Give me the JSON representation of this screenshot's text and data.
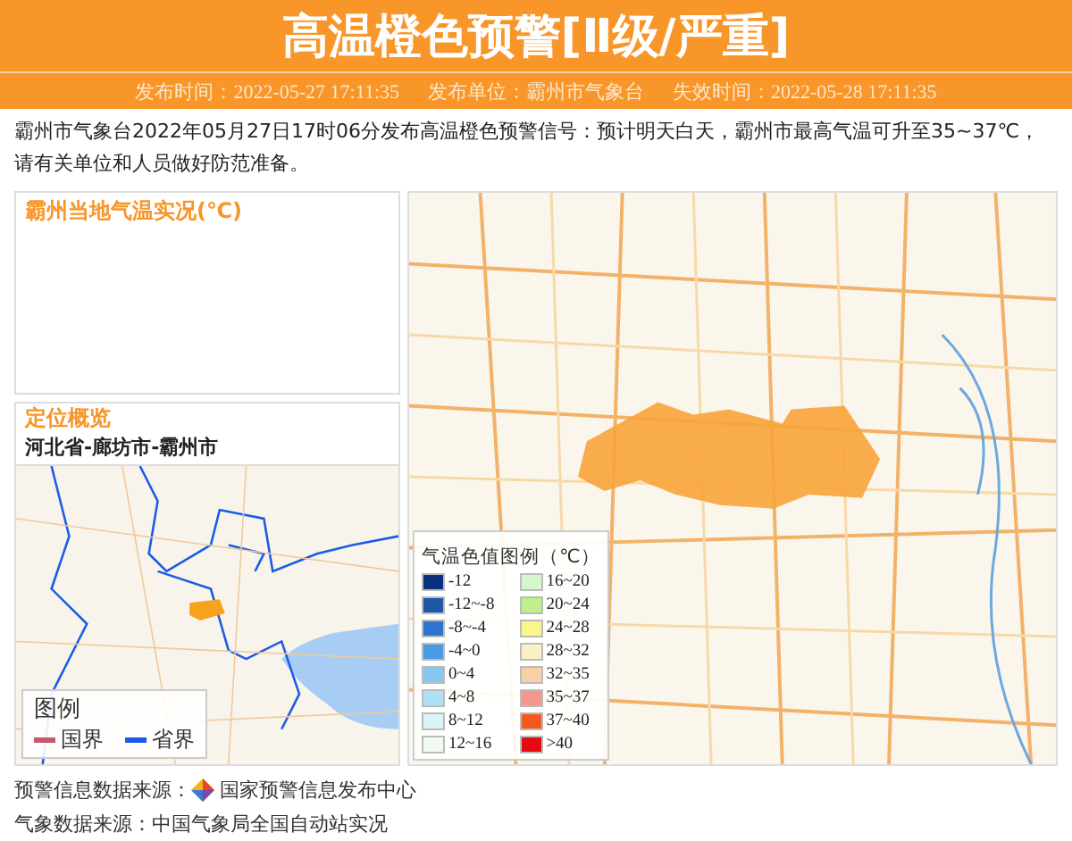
{
  "header": {
    "title": "高温橙色预警[Ⅱ级/严重]"
  },
  "meta": [
    {
      "label": "发布时间：",
      "value": "2022-05-27 17:11:35"
    },
    {
      "label": "发布单位：",
      "value": "霸州市气象台"
    },
    {
      "label": "失效时间：",
      "value": "2022-05-28 17:11:35"
    }
  ],
  "description": "霸州市气象台2022年05月27日17时06分发布高温橙色预警信号：预计明天白天，霸州市最高气温可升至35~37℃，请有关单位和人员做好防范准备。",
  "temperature_panel": {
    "title": "霸州当地气温实况(℃)"
  },
  "location_panel": {
    "title": "定位概览",
    "path": "河北省-廊坊市-霸州市",
    "legend": {
      "title": "图例",
      "items": [
        {
          "label": "国界",
          "color": "#c8586c"
        },
        {
          "label": "省界",
          "color": "#1a5ce6"
        }
      ]
    }
  },
  "temperature_legend": {
    "title": "气温色值图例（℃）",
    "items": [
      {
        "label": "-12",
        "color": "#0a2f7f"
      },
      {
        "label": "-12~-8",
        "color": "#1f57a8"
      },
      {
        "label": "-8~-4",
        "color": "#2e74cf"
      },
      {
        "label": "-4~0",
        "color": "#4a9be6"
      },
      {
        "label": "0~4",
        "color": "#86c8f2"
      },
      {
        "label": "4~8",
        "color": "#b0e0f4"
      },
      {
        "label": "8~12",
        "color": "#d8f4f6"
      },
      {
        "label": "12~16",
        "color": "#f1fbef"
      },
      {
        "label": "16~20",
        "color": "#d6f5cf"
      },
      {
        "label": "20~24",
        "color": "#bff08a"
      },
      {
        "label": "24~28",
        "color": "#fbf58e"
      },
      {
        "label": "28~32",
        "color": "#fdefc6"
      },
      {
        "label": "32~35",
        "color": "#f8cfa6"
      },
      {
        "label": "35~37",
        "color": "#f4968a"
      },
      {
        "label": "37~40",
        "color": "#f45a1e"
      },
      {
        "label": ">40",
        "color": "#e30b12"
      }
    ]
  },
  "sources": [
    {
      "label": "预警信息数据来源：",
      "value": "国家预警信息发布中心",
      "logo": true
    },
    {
      "label": "气象数据来源：",
      "value": "中国气象局全国自动站实况",
      "logo": false
    }
  ]
}
